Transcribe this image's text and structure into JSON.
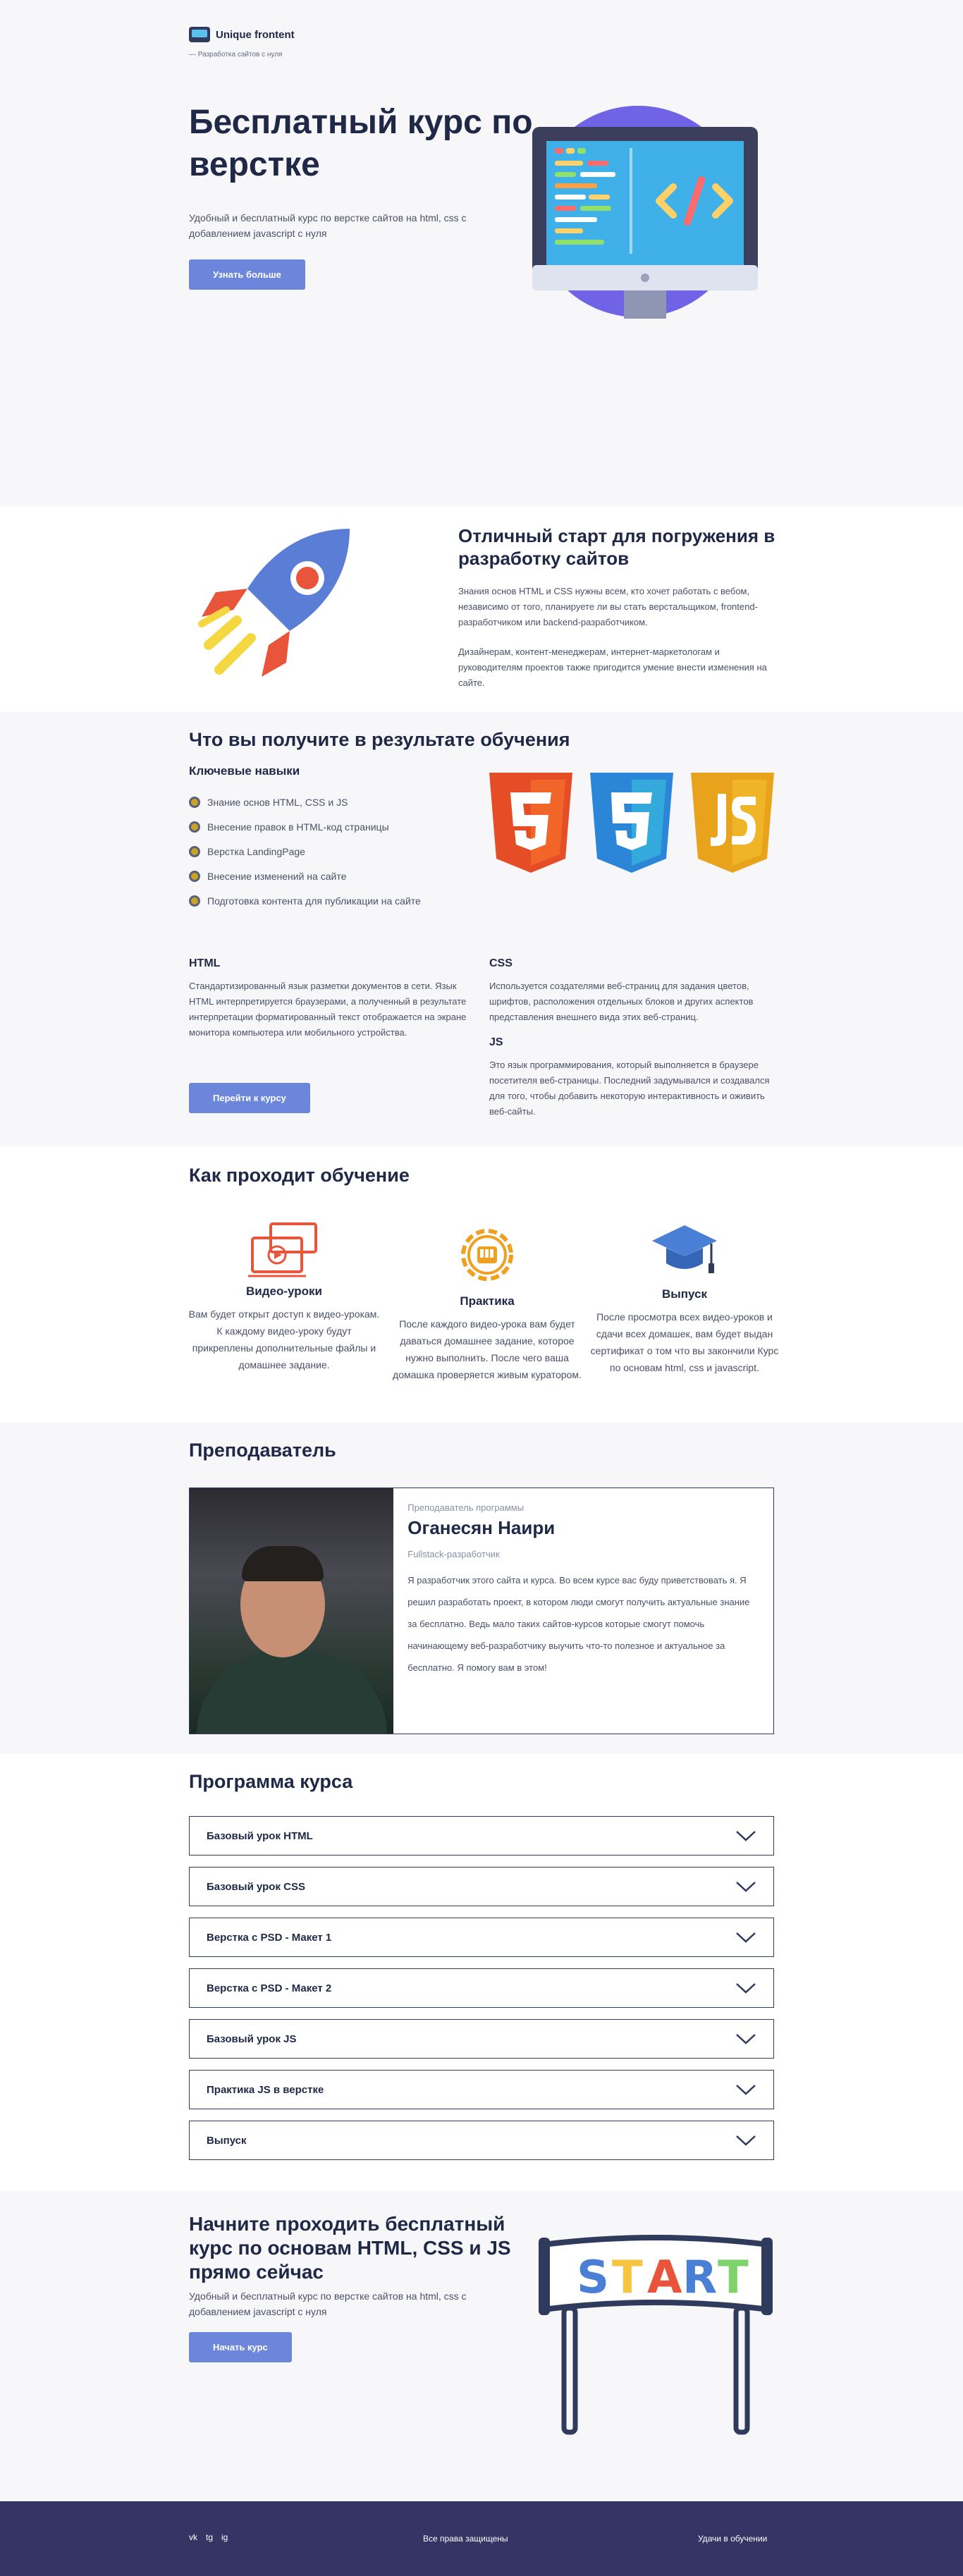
{
  "brand": {
    "name": "Unique frontent",
    "tagline": "— Разработка сайтов с нуля"
  },
  "hero": {
    "title": "Бесплатный курс по верстке",
    "lead": "Удобный и бесплатный курс по верстке сайтов на html, css с добавлением javascript с нуля",
    "button": "Узнать больше"
  },
  "about": {
    "title": "Отличный старт для погружения в разработку сайтов",
    "text1": "Знания основ HTML и CSS нужны всем, кто хочет работать с вебом, независимо от того, планируете ли вы стать верстальщиком, frontend-разработчиком или backend-разработчиком.",
    "text2": "Дизайнерам, контент-менеджерам, интернет-маркетологам и руководителям проектов также пригодится умение внести изменения на сайте."
  },
  "results": {
    "title": "Что вы получите в результате обучения",
    "skills_title": "Ключевые навыки",
    "skills": [
      "Знание основ HTML, CSS и JS",
      "Внесение правок в HTML-код страницы",
      "Верстка LandingPage",
      "Внесение изменений на сайте",
      "Подготовка контента для публикации на сайте"
    ],
    "html": {
      "title": "HTML",
      "text": "Стандартизированный язык разметки документов в сети. Язык HTML интерпретируется браузерами, а полученный в результате интерпретации форматированный текст отображается на экране монитора компьютера или мобильного устройства."
    },
    "css": {
      "title": "CSS",
      "text": "Используется создателями веб-страниц для задания цветов, шрифтов, расположения отдельных блоков и других аспектов представления внешнего вида этих веб-страниц."
    },
    "js": {
      "title": "JS",
      "text": "Это язык программирования, который выполняется в браузере посетителя веб-страницы. Последний задумывался и создавался для того, чтобы добавить некоторую интерактивность и оживить веб-сайты."
    },
    "button": "Перейти к курсу",
    "colors": {
      "html": "#e44d26",
      "css": "#2b86d8",
      "js": "#e9a21b"
    }
  },
  "process": {
    "title": "Как проходит обучение",
    "steps": [
      {
        "title": "Видео-уроки",
        "text": "Вам будет открыт доступ к видео-урокам. К каждому видео-уроку будут прикреплены дополнительные файлы и домашнее задание."
      },
      {
        "title": "Практика",
        "text": "После каждого видео-урока вам будет даваться домашнее задание, которое нужно выполнить. После чего ваша домашка проверяется живым куратором."
      },
      {
        "title": "Выпуск",
        "text": "После просмотра всех видео-уроков и сдачи всех домашек, вам будет выдан сертификат о том что вы закончили Курс по основам html, css и javascript."
      }
    ]
  },
  "teacher": {
    "title": "Преподаватель",
    "role": "Преподаватель программы",
    "name": "Оганесян Наири",
    "spec": "Fullstack-разработчик",
    "bio": "Я разработчик этого сайта и курса. Во всем курсе вас буду приветствовать я. Я решил разработать проект, в котором люди смогут получить актуальные знание за бесплатно. Ведь мало таких сайтов-курсов которые смогут помочь начинающему веб-разработчику выучить что-то полезное и актуальное за бесплатно. Я помогу вам в этом!"
  },
  "program": {
    "title": "Программа курса",
    "items": [
      "Базовый урок HTML",
      "Базовый урок CSS",
      "Верстка с PSD - Макет 1",
      "Верстка с PSD - Макет 2",
      "Базовый урок JS",
      "Практика JS в верстке",
      "Выпуск"
    ]
  },
  "cta": {
    "title": "Начните проходить бесплатный курс по основам HTML, CSS и JS прямо сейчас",
    "text": "Удобный и бесплатный курс по верстке сайтов на html, css с добавлением javascript с нуля",
    "button": "Начать курс",
    "start_letters": [
      "S",
      "T",
      "A",
      "R",
      "T"
    ]
  },
  "footer": {
    "social": [
      "vk",
      "tg",
      "ig"
    ],
    "rights": "Все права защищены",
    "luck": "Удачи в обучении"
  }
}
